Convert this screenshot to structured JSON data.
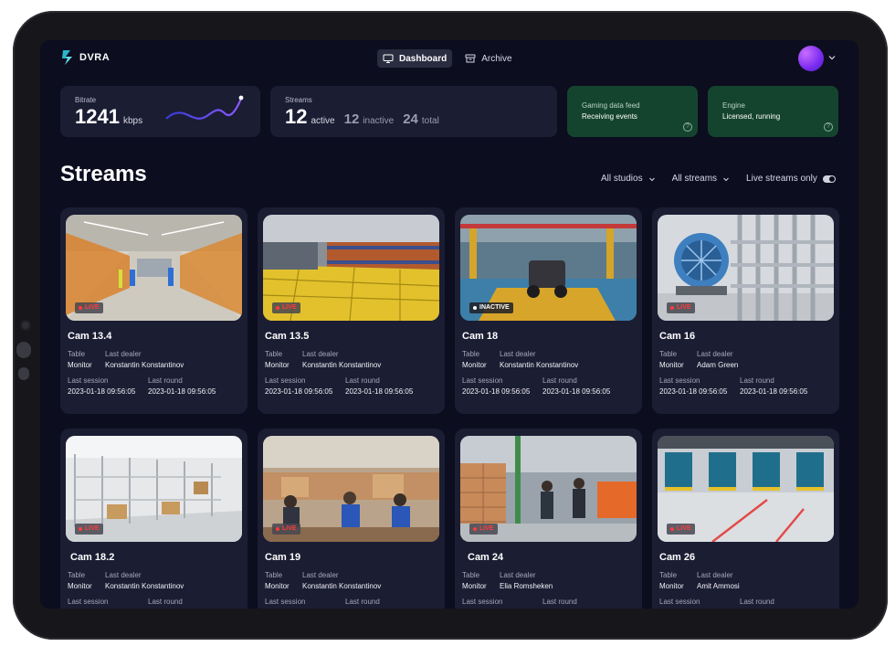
{
  "app": {
    "name": "DVRA"
  },
  "nav": [
    {
      "label": "Dashboard",
      "active": true,
      "icon": "monitor-icon"
    },
    {
      "label": "Archive",
      "active": false,
      "icon": "archive-box-icon"
    }
  ],
  "stats": {
    "bitrate": {
      "label": "Bitrate",
      "value": "1241",
      "unit": "kbps"
    },
    "streams": {
      "label": "Streams",
      "active_value": "12",
      "active_label": "active",
      "inactive_value": "12",
      "inactive_label": "inactive",
      "total_value": "24",
      "total_label": "total"
    },
    "gaming_feed": {
      "title": "Gaming data feed",
      "status": "Receiving events"
    },
    "engine": {
      "title": "Engine",
      "status": "Licensed, running"
    }
  },
  "streams_section": {
    "title": "Streams",
    "filters": {
      "studios": "All studios",
      "streams": "All streams",
      "live_only": "Live streams only"
    }
  },
  "field_labels": {
    "table": "Table",
    "last_dealer": "Last dealer",
    "last_session": "Last session",
    "last_round": "Last round"
  },
  "cameras": [
    {
      "name": "Cam 13.4",
      "status": "LIVE",
      "table": "Monitor",
      "dealer": "Konstantin Konstantinov",
      "session": "2023-01-18 09:56:05",
      "round": "2023-01-18 09:56:05"
    },
    {
      "name": "Cam 13.5",
      "status": "LIVE",
      "table": "Monitor",
      "dealer": "Konstantin Konstantinov",
      "session": "2023-01-18 09:56:05",
      "round": "2023-01-18 09:56:05"
    },
    {
      "name": "Cam 18",
      "status": "INACTIVE",
      "table": "Monitor",
      "dealer": "Konstantin Konstantinov",
      "session": "2023-01-18 09:56:05",
      "round": "2023-01-18 09:56:05"
    },
    {
      "name": "Cam 16",
      "status": "LIVE",
      "table": "Monitor",
      "dealer": "Adam Green",
      "session": "2023-01-18 09:56:05",
      "round": "2023-01-18 09:56:05"
    },
    {
      "name": "Cam 18.2",
      "status": "LIVE",
      "table": "Monitor",
      "dealer": "Konstantin Konstantinov",
      "session": "",
      "round": ""
    },
    {
      "name": "Cam 19",
      "status": "LIVE",
      "table": "Monitor",
      "dealer": "Konstantin Konstantinov",
      "session": "",
      "round": ""
    },
    {
      "name": "Cam 24",
      "status": "LIVE",
      "table": "Monitor",
      "dealer": "Elia Romsheken",
      "session": "",
      "round": ""
    },
    {
      "name": "Cam 26",
      "status": "LIVE",
      "table": "Monitor",
      "dealer": "Amit Ammosi",
      "session": "",
      "round": ""
    }
  ],
  "colors": {
    "background": "#0c0d1f",
    "card": "#1b1d33",
    "feed_card": "#15442e",
    "live": "#ff3b3b",
    "sparkline": "#6a4cff"
  }
}
